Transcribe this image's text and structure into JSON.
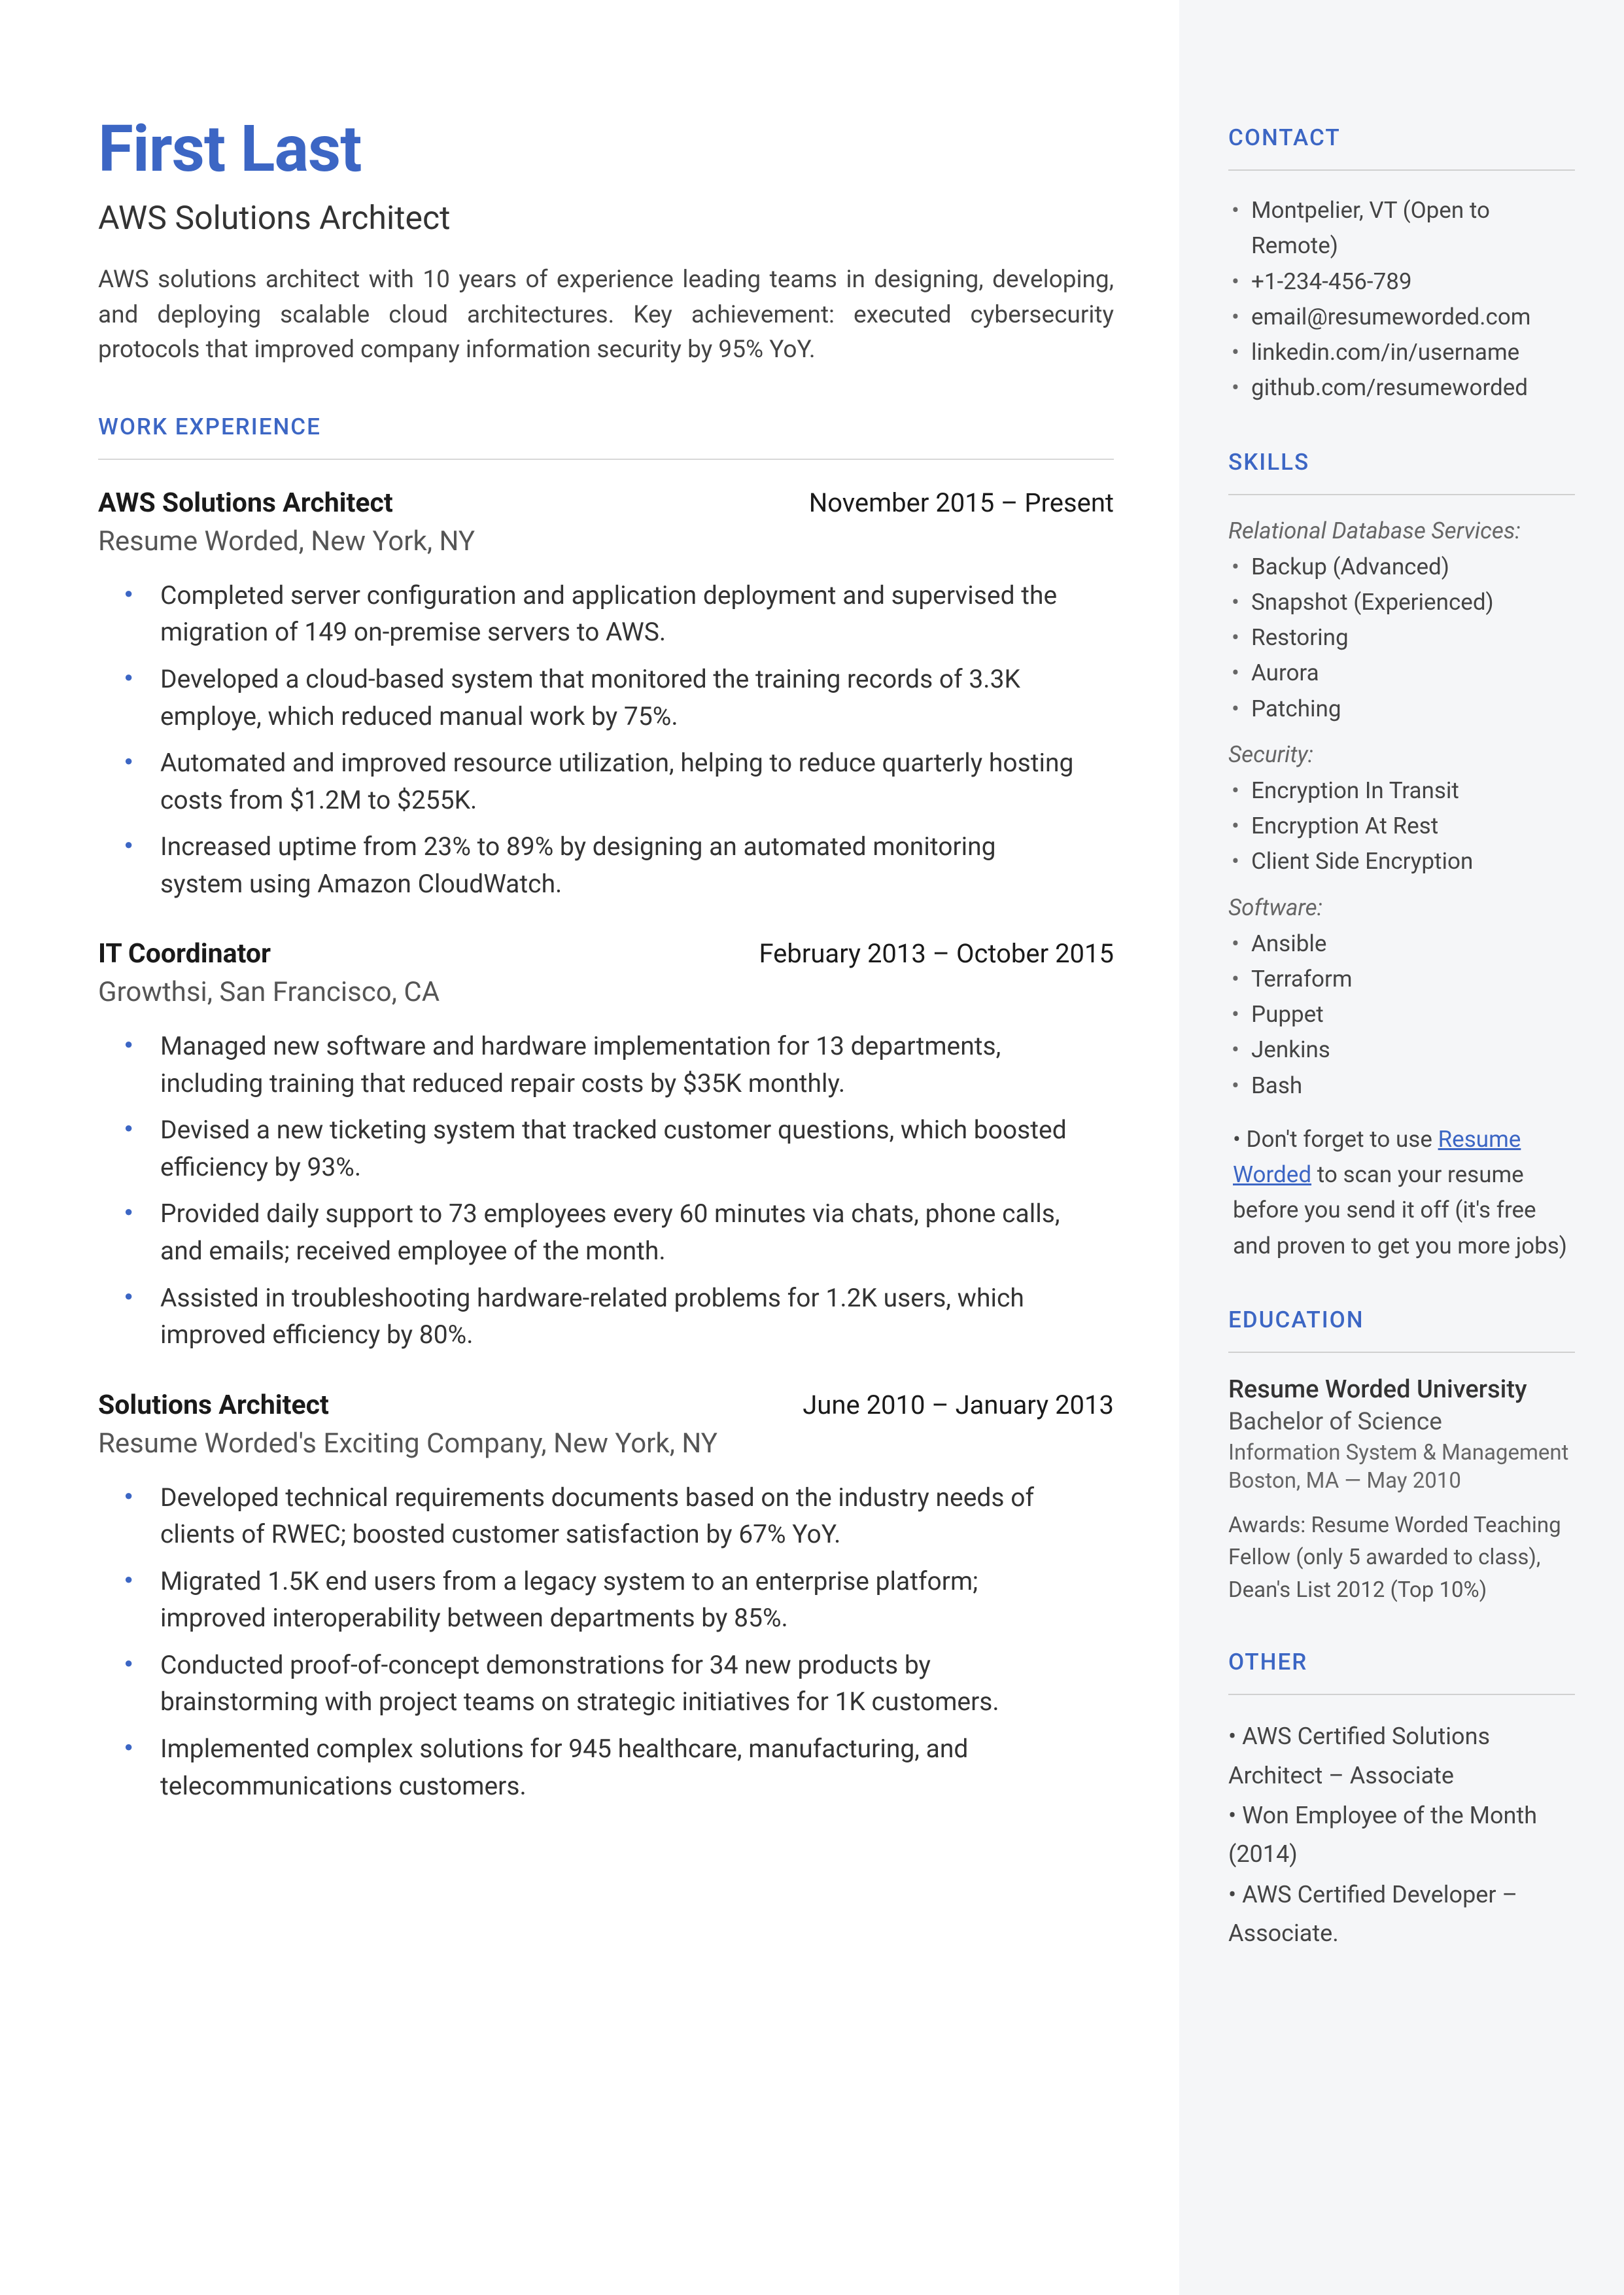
{
  "header": {
    "name": "First Last",
    "title": "AWS Solutions Architect",
    "summary": "AWS solutions architect with 10 years of experience leading teams in designing, developing, and deploying scalable cloud architectures. Key achievement: executed cybersecurity protocols that improved company information security by 95% YoY."
  },
  "sections": {
    "work": "WORK EXPERIENCE",
    "contact": "CONTACT",
    "skills": "SKILLS",
    "education": "EDUCATION",
    "other": "OTHER"
  },
  "jobs": [
    {
      "title": "AWS Solutions Architect",
      "dates": "November 2015 – Present",
      "company": "Resume Worded, New York, NY",
      "bullets": [
        "Completed server configuration and application deployment and supervised the migration of 149 on-premise servers to AWS.",
        "Developed a cloud-based system that monitored the training records of 3.3K employe, which reduced manual work by 75%.",
        "Automated and improved resource utilization, helping to reduce quarterly hosting costs from $1.2M to $255K.",
        "Increased uptime from 23% to 89% by designing an automated monitoring system using Amazon CloudWatch."
      ]
    },
    {
      "title": "IT Coordinator",
      "dates": "February 2013 – October 2015",
      "company": "Growthsi, San Francisco, CA",
      "bullets": [
        "Managed new software and hardware implementation for 13 departments, including training that reduced repair costs by $35K monthly.",
        "Devised a new ticketing system that tracked customer questions, which boosted efficiency by 93%.",
        "Provided daily support to 73 employees every 60 minutes via chats, phone calls, and emails; received employee of the month.",
        "Assisted in troubleshooting hardware-related problems for 1.2K users, which improved efficiency by 80%."
      ]
    },
    {
      "title": "Solutions Architect",
      "dates": "June 2010 – January 2013",
      "company": "Resume Worded's Exciting Company, New York, NY",
      "bullets": [
        "Developed technical requirements documents based on the industry needs of clients of RWEC; boosted customer satisfaction by 67% YoY.",
        "Migrated 1.5K end users from a legacy system to an enterprise platform; improved interoperability between departments by 85%.",
        "Conducted proof-of-concept demonstrations for 34 new products by brainstorming with project teams on strategic initiatives for 1K customers.",
        "Implemented complex solutions for 945 healthcare, manufacturing, and telecommunications customers."
      ]
    }
  ],
  "contact": [
    "Montpelier, VT (Open to Remote)",
    "+1-234-456-789",
    "email@resumeworded.com",
    "linkedin.com/in/username",
    "github.com/resumeworded"
  ],
  "skills": {
    "groups": [
      {
        "title": "Relational Database Services:",
        "items": [
          "Backup (Advanced)",
          "Snapshot (Experienced)",
          "Restoring",
          "Aurora",
          "Patching"
        ]
      },
      {
        "title": "Security:",
        "items": [
          "Encryption In Transit",
          "Encryption At Rest",
          "Client Side Encryption"
        ]
      },
      {
        "title": "Software:",
        "items": [
          "Ansible",
          "Terraform",
          "Puppet",
          "Jenkins",
          "Bash"
        ]
      }
    ],
    "tip_prefix": "•  Don't forget to use ",
    "tip_link": "Resume Worded",
    "tip_suffix": " to scan your resume before you send it off (it's free and proven to get you more jobs)"
  },
  "education": {
    "school": "Resume Worded University",
    "degree": "Bachelor of Science",
    "field": "Information System & Management",
    "loc": "Boston, MA — May 2010",
    "awards": "Awards: Resume Worded Teaching Fellow (only 5 awarded to class), Dean's List 2012 (Top 10%)"
  },
  "other": [
    "•  AWS Certified Solutions Architect – Associate",
    "•  Won Employee of the Month (2014)",
    "•  AWS Certified Developer – Associate."
  ]
}
